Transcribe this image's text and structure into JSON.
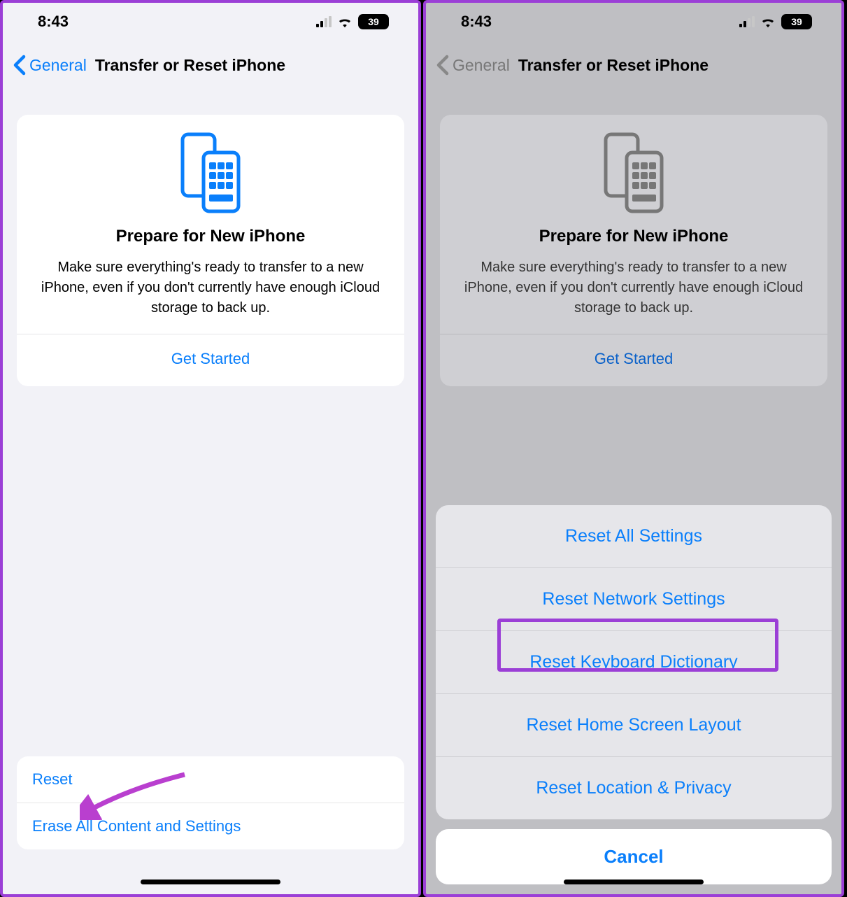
{
  "status": {
    "time": "8:43",
    "battery": "39"
  },
  "nav": {
    "back": "General",
    "title": "Transfer or Reset iPhone"
  },
  "card": {
    "heading": "Prepare for New iPhone",
    "body": "Make sure everything's ready to transfer to a new iPhone, even if you don't currently have enough iCloud storage to back up.",
    "cta": "Get Started"
  },
  "bottom": {
    "reset": "Reset",
    "erase": "Erase All Content and Settings"
  },
  "sheet": {
    "options": [
      "Reset All Settings",
      "Reset Network Settings",
      "Reset Keyboard Dictionary",
      "Reset Home Screen Layout",
      "Reset Location & Privacy"
    ],
    "cancel": "Cancel"
  }
}
